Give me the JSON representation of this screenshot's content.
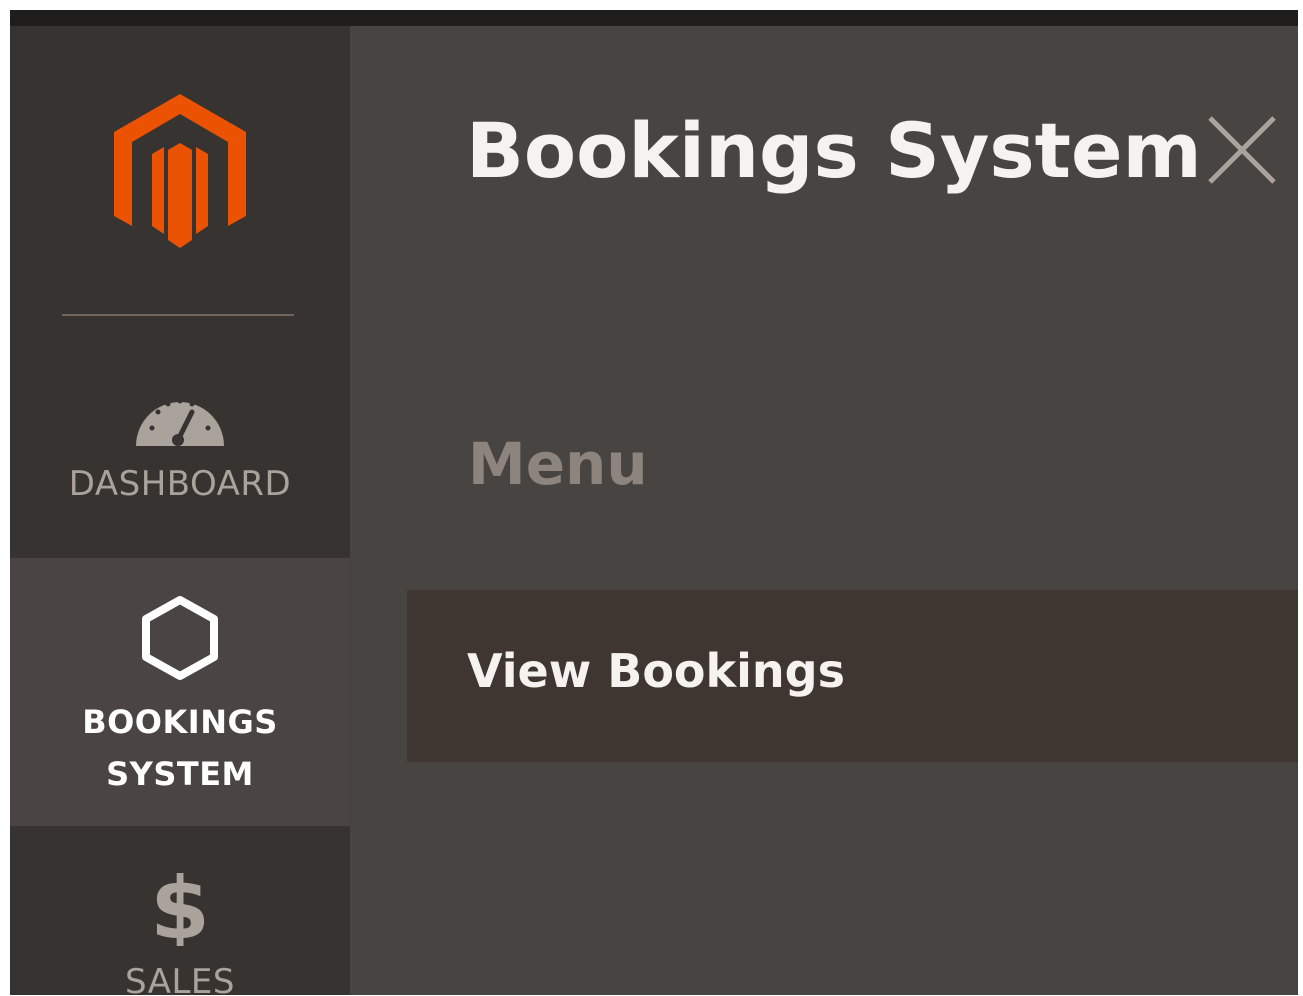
{
  "topbar": {},
  "sidebar": {
    "logo": {
      "icon": "magento-logo-icon",
      "color": "#eb5202"
    },
    "items": [
      {
        "label": "DASHBOARD",
        "icon": "speedometer-icon"
      },
      {
        "label": "BOOKINGS SYSTEM",
        "icon": "hexagon-icon",
        "active": true
      },
      {
        "label": "SALES",
        "icon": "dollar-icon"
      }
    ]
  },
  "panel": {
    "title": "Bookings System",
    "close_icon": "close-icon",
    "menu_heading": "Menu",
    "items": [
      {
        "label": "View Bookings"
      }
    ]
  },
  "colors": {
    "sidebar_bg": "#373330",
    "sidebar_active_bg": "#4a4542",
    "panel_bg": "#484441",
    "submenu_item_bg": "#3f3632",
    "accent": "#eb5202"
  }
}
